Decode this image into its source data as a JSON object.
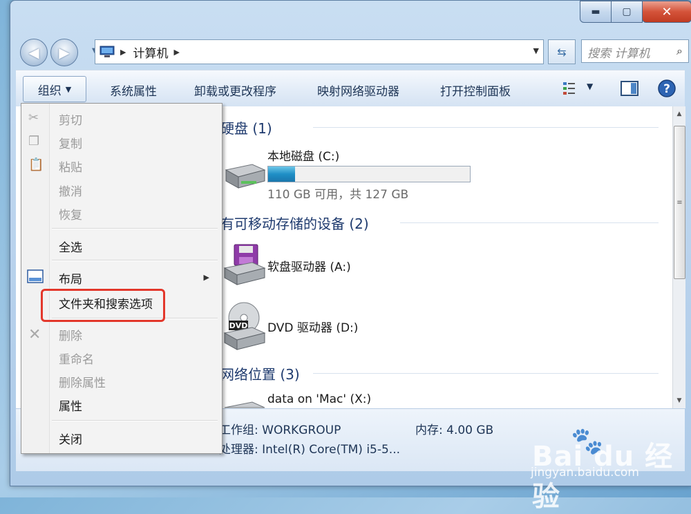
{
  "window": {
    "caption": {
      "minimize": "▬",
      "maximize": "▢",
      "close": "✕"
    }
  },
  "address_bar": {
    "breadcrumb": "计算机",
    "search_placeholder": "搜索 计算机"
  },
  "toolbar": {
    "organize": "组织",
    "system_properties": "系统属性",
    "uninstall": "卸载或更改程序",
    "map_drive": "映射网络驱动器",
    "control_panel": "打开控制面板"
  },
  "content": {
    "groups": [
      {
        "header": "硬盘 (1)"
      },
      {
        "header": "有可移动存储的设备 (2)"
      },
      {
        "header": "网络位置 (3)"
      }
    ],
    "drives": {
      "c": {
        "name": "本地磁盘 (C:)",
        "usage_text": "110 GB 可用，共 127 GB",
        "used_fraction": 0.134
      },
      "a": {
        "name": "软盘驱动器 (A:)"
      },
      "d": {
        "name": "DVD 驱动器 (D:)",
        "dvd_label": "DVD"
      },
      "x": {
        "name": "data on 'Mac' (X:)"
      }
    }
  },
  "details": {
    "workgroup": "工作组: WORKGROUP",
    "memory": "内存: 4.00 GB",
    "processor": "处理器: Intel(R) Core(TM) i5-5..."
  },
  "menu": {
    "cut": "剪切",
    "copy": "复制",
    "paste": "粘贴",
    "undo": "撤消",
    "redo": "恢复",
    "select_all": "全选",
    "layout": "布局",
    "folder_options": "文件夹和搜索选项",
    "delete": "删除",
    "rename": "重命名",
    "remove_properties": "删除属性",
    "properties": "属性",
    "close": "关闭"
  },
  "watermark": {
    "logo": "Bai du 经验",
    "url": "jingyan.baidu.com"
  }
}
